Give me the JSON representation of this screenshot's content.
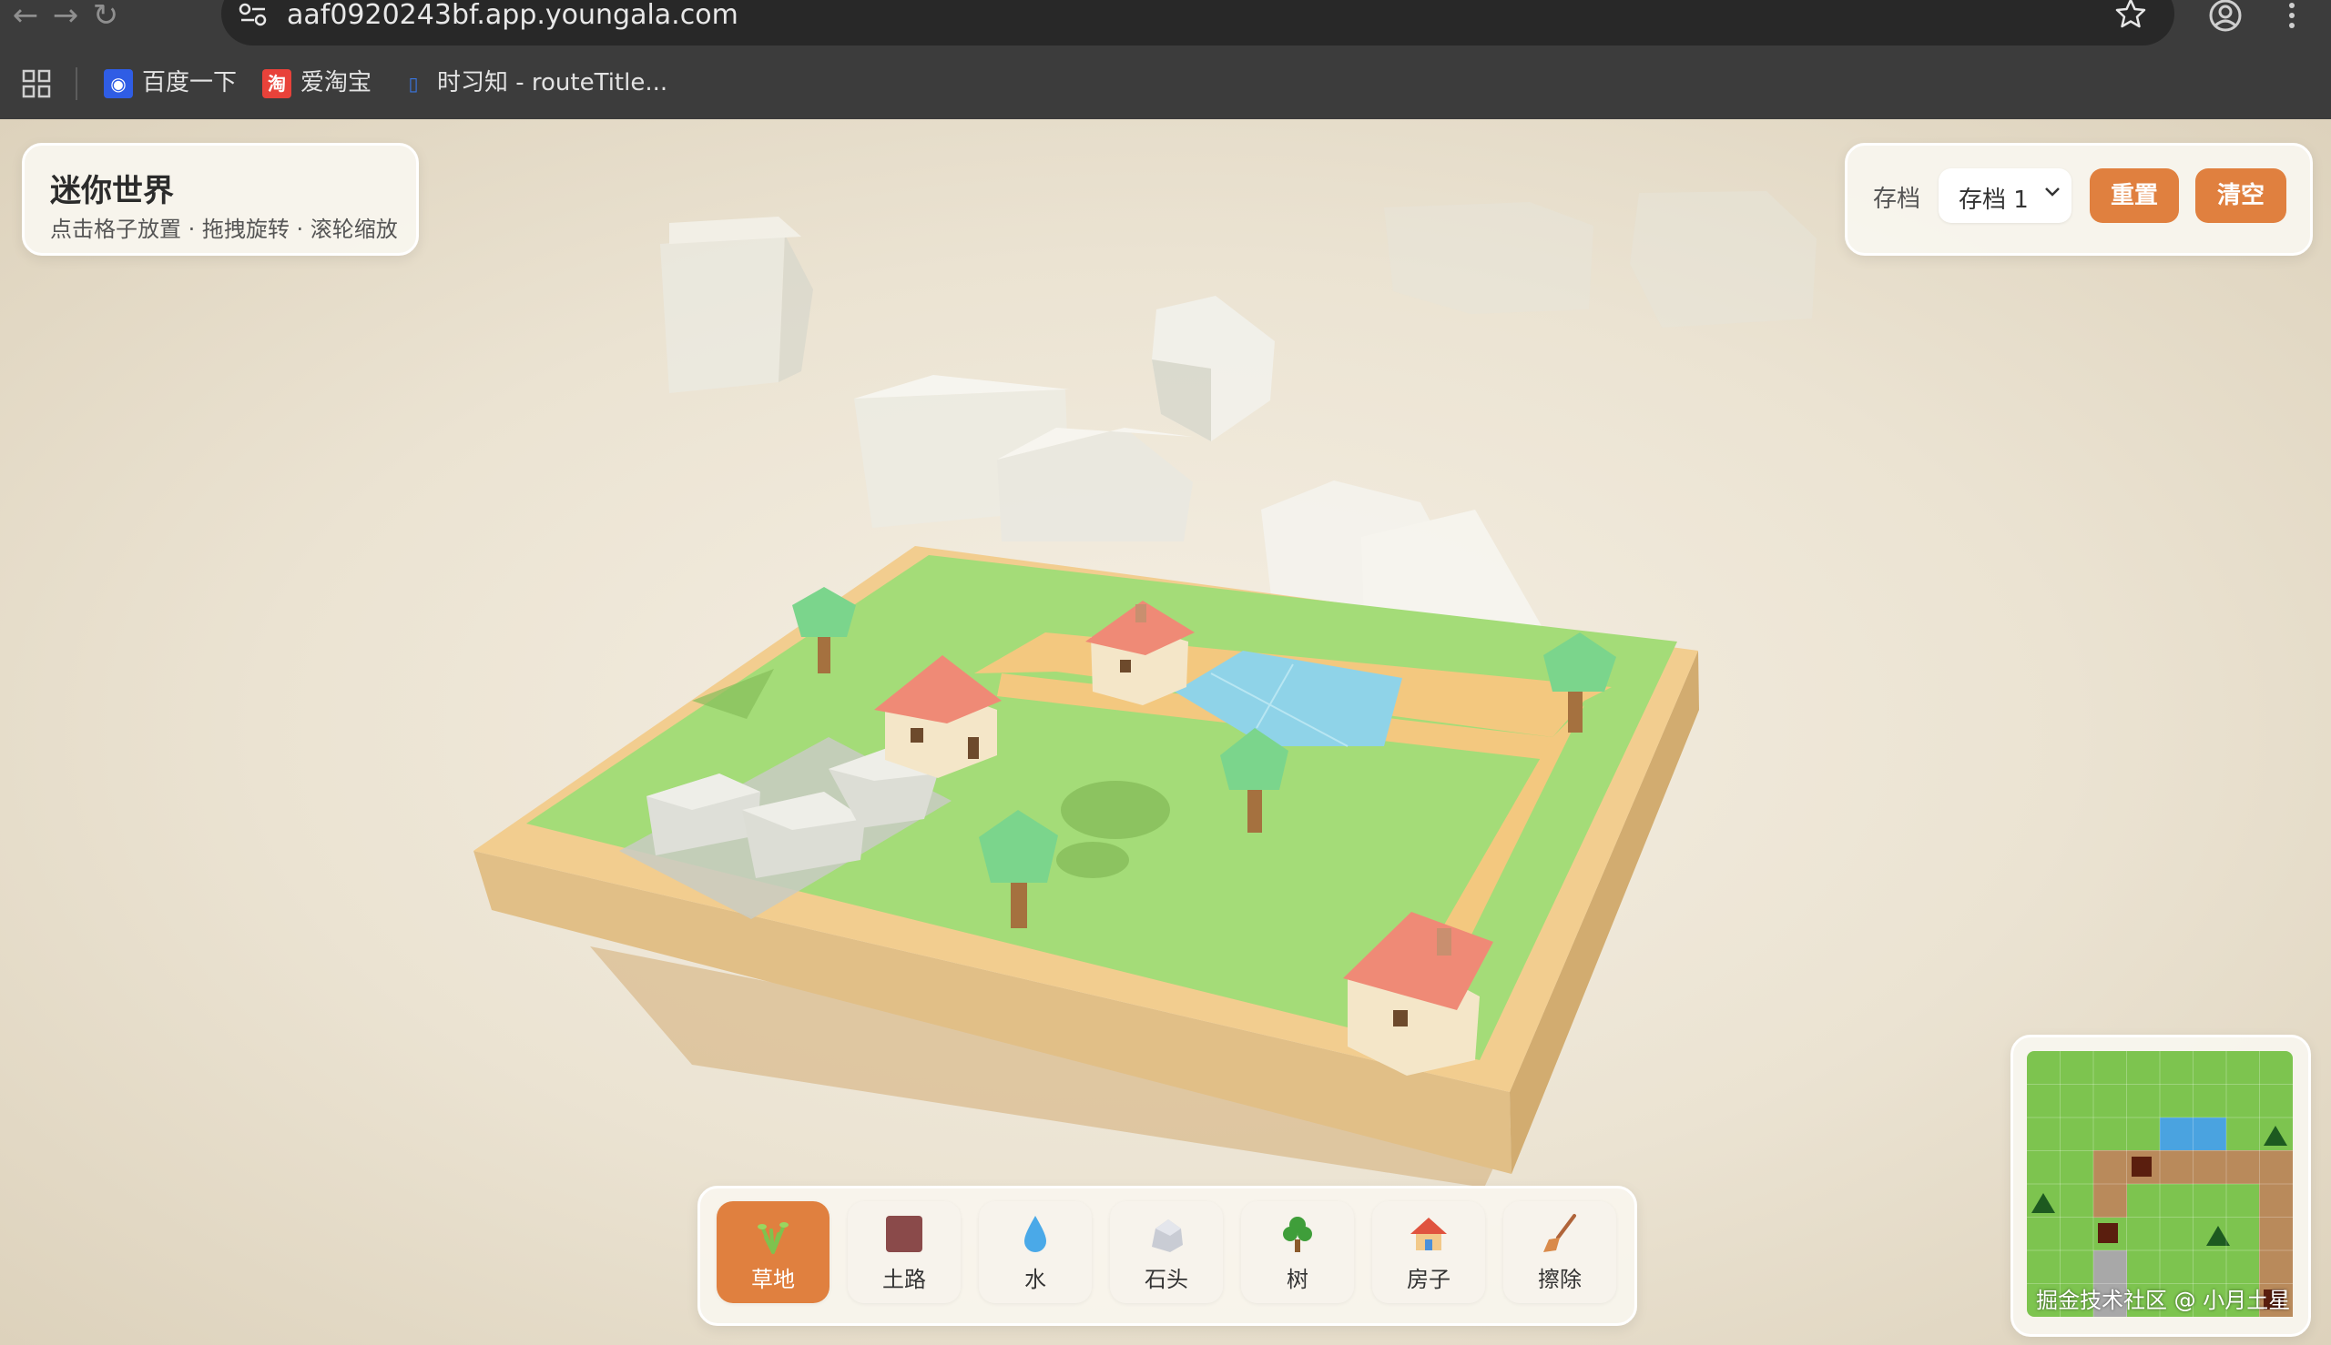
{
  "browser": {
    "url": "aaf0920243bf.app.youngala.com",
    "bookmarks": [
      {
        "label": "百度一下",
        "icon": "baidu-icon",
        "color": "#2f5de5"
      },
      {
        "label": "爱淘宝",
        "icon": "taobao-icon",
        "color": "#e8423a"
      },
      {
        "label": "时习知 - routeTitle...",
        "icon": "book-icon",
        "color": "#3a76e0"
      }
    ]
  },
  "header": {
    "title": "迷你世界",
    "subtitle": "点击格子放置 · 拖拽旋转 · 滚轮缩放"
  },
  "save": {
    "label": "存档",
    "selected": "存档 1",
    "reset_label": "重置",
    "clear_label": "清空"
  },
  "toolbar": {
    "tools": [
      {
        "label": "草地",
        "icon": "grass-icon",
        "active": true
      },
      {
        "label": "土路",
        "icon": "dirt-icon",
        "active": false
      },
      {
        "label": "水",
        "icon": "water-icon",
        "active": false
      },
      {
        "label": "石头",
        "icon": "rock-icon",
        "active": false
      },
      {
        "label": "树",
        "icon": "tree-icon",
        "active": false
      },
      {
        "label": "房子",
        "icon": "house-icon",
        "active": false
      },
      {
        "label": "擦除",
        "icon": "erase-icon",
        "active": false
      }
    ]
  },
  "watermark": "掘金技术社区 @ 小月土星",
  "colors": {
    "accent": "#e0803f",
    "grass": "#a4dc78",
    "dirt": "#f2cd8f",
    "water": "#8fd3e8",
    "roof": "#ef8a76",
    "minimap_grass": "#7dc44f",
    "minimap_water": "#4aa3e0",
    "minimap_dirt": "#b98a5b"
  }
}
